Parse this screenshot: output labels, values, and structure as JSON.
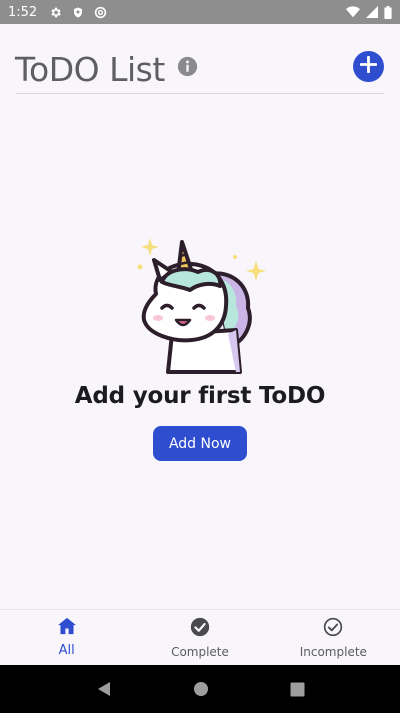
{
  "status_bar": {
    "time": "1:52",
    "icons": [
      "gear-icon",
      "shield-icon",
      "at-icon",
      "wifi-icon",
      "signal-icon",
      "battery-icon"
    ]
  },
  "header": {
    "title": "ToDO List",
    "info_icon": "info-icon",
    "add_icon": "plus-icon"
  },
  "empty_state": {
    "illustration": "unicorn-illustration",
    "title": "Add your first ToDO",
    "button_label": "Add Now"
  },
  "bottom_nav": {
    "items": [
      {
        "label": "All",
        "icon": "home-icon",
        "active": true
      },
      {
        "label": "Complete",
        "icon": "check-circle-filled-icon",
        "active": false
      },
      {
        "label": "Incomplete",
        "icon": "check-circle-outline-icon",
        "active": false
      }
    ]
  },
  "system_nav": {
    "icons": [
      "back-icon",
      "home-circle-icon",
      "recents-icon"
    ]
  },
  "colors": {
    "accent": "#2f4ecf",
    "background": "#f8f6fb",
    "status_bar": "#8e8e8e",
    "title_text": "#5f5f63"
  }
}
